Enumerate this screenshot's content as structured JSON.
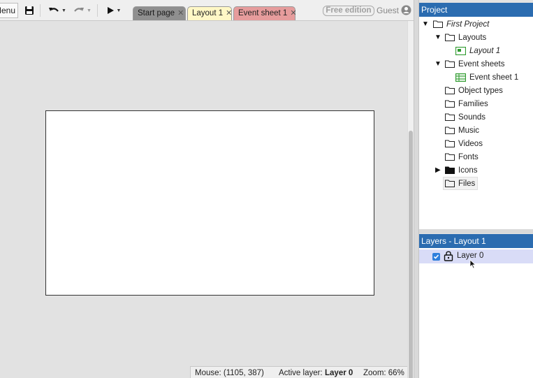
{
  "toolbar": {
    "menu_label": "Menu",
    "tabs": [
      {
        "label": "Start page",
        "color": "#8f8f8f"
      },
      {
        "label": "Layout 1",
        "color": "#fff7c6"
      },
      {
        "label": "Event sheet 1",
        "color": "#e69c9c"
      }
    ],
    "tab_close": "✕",
    "edition_badge": "Free edition",
    "user_label": "Guest"
  },
  "status": {
    "mouse": "Mouse: (1105, 387)",
    "active_layer_label": "Active layer:",
    "active_layer_value": "Layer 0",
    "zoom": "Zoom: 66%"
  },
  "project": {
    "title": "Project",
    "root": "First Project",
    "items": [
      {
        "label": "Layouts",
        "icon": "folder-icon"
      },
      {
        "label": "Layout 1",
        "icon": "layout-icon"
      },
      {
        "label": "Event sheets",
        "icon": "folder-icon"
      },
      {
        "label": "Event sheet 1",
        "icon": "event-sheet-icon"
      },
      {
        "label": "Object types",
        "icon": "folder-icon"
      },
      {
        "label": "Families",
        "icon": "folder-icon"
      },
      {
        "label": "Sounds",
        "icon": "folder-icon"
      },
      {
        "label": "Music",
        "icon": "folder-icon"
      },
      {
        "label": "Videos",
        "icon": "folder-icon"
      },
      {
        "label": "Fonts",
        "icon": "folder-icon"
      },
      {
        "label": "Icons",
        "icon": "folder-filled-icon"
      },
      {
        "label": "Files",
        "icon": "folder-icon"
      }
    ]
  },
  "layers": {
    "title": "Layers - Layout 1",
    "items": [
      {
        "label": "Layer 0",
        "visible": true,
        "locked": false
      }
    ]
  },
  "colors": {
    "panel_header": "#2b6cb0",
    "layout_icon": "#2e9a2e",
    "selected_layer": "#d9dcf7"
  }
}
